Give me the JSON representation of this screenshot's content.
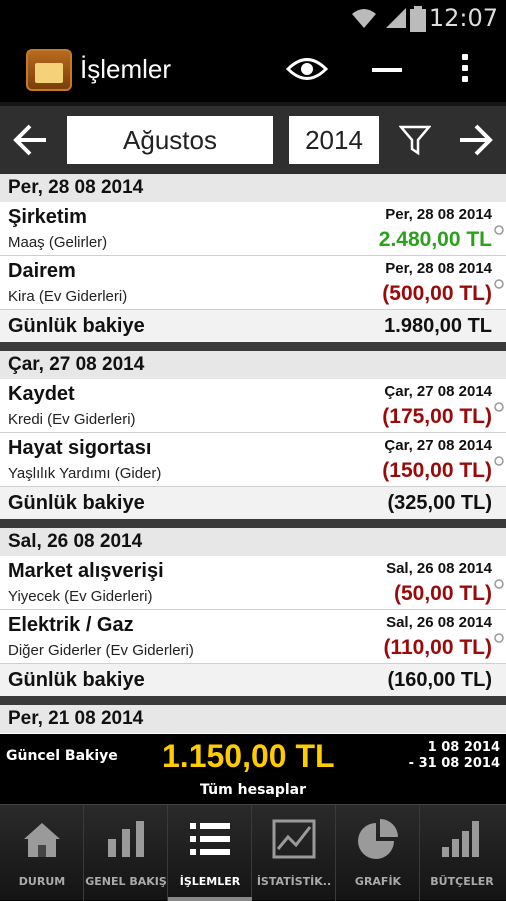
{
  "status_bar": {
    "time": "12:07"
  },
  "action_bar": {
    "title": "İşlemler"
  },
  "selector": {
    "month": "Ağustos",
    "year": "2014"
  },
  "colors": {
    "income": "#2ca11c",
    "expense": "#9b0a0a",
    "total": "#ffcc00"
  },
  "days": [
    {
      "header": "Per, 28 08 2014",
      "transactions": [
        {
          "name": "Şirketim",
          "category": "Maaş (Gelirler)",
          "date": "Per, 28 08 2014",
          "amount": "2.480,00 TL",
          "type": "income"
        },
        {
          "name": "Dairem",
          "category": "Kira (Ev Giderleri)",
          "date": "Per, 28 08 2014",
          "amount": "(500,00 TL)",
          "type": "expense"
        }
      ],
      "balance_label": "Günlük bakiye",
      "balance_value": "1.980,00 TL"
    },
    {
      "header": "Çar, 27 08 2014",
      "transactions": [
        {
          "name": "Kaydet",
          "category": "Kredi (Ev Giderleri)",
          "date": "Çar, 27 08 2014",
          "amount": "(175,00 TL)",
          "type": "expense"
        },
        {
          "name": "Hayat sigortası",
          "category": "Yaşlılık Yardımı (Gider)",
          "date": "Çar, 27 08 2014",
          "amount": "(150,00 TL)",
          "type": "expense"
        }
      ],
      "balance_label": "Günlük bakiye",
      "balance_value": "(325,00 TL)"
    },
    {
      "header": "Sal, 26 08 2014",
      "transactions": [
        {
          "name": "Market alışverişi",
          "category": "Yiyecek (Ev Giderleri)",
          "date": "Sal, 26 08 2014",
          "amount": "(50,00 TL)",
          "type": "expense"
        },
        {
          "name": "Elektrik / Gaz",
          "category": "Diğer Giderler (Ev Giderleri)",
          "date": "Sal, 26 08 2014",
          "amount": "(110,00 TL)",
          "type": "expense"
        }
      ],
      "balance_label": "Günlük bakiye",
      "balance_value": "(160,00 TL)"
    }
  ],
  "partial_header": "Per, 21 08 2014",
  "summary": {
    "label": "Güncel Bakiye",
    "total": "1.150,00 TL",
    "range_start": "1 08 2014",
    "range_end": "- 31 08 2014",
    "accounts": "Tüm hesaplar"
  },
  "tabs": [
    {
      "label": "DURUM",
      "icon": "house-icon"
    },
    {
      "label": "GENEL BAKIŞ",
      "icon": "bar-chart-icon"
    },
    {
      "label": "İŞLEMLER",
      "icon": "list-icon",
      "active": true
    },
    {
      "label": "İSTATİSTİK..",
      "icon": "line-chart-icon"
    },
    {
      "label": "GRAFİK",
      "icon": "pie-chart-icon"
    },
    {
      "label": "BÜTÇELER",
      "icon": "budget-bars-icon"
    }
  ]
}
